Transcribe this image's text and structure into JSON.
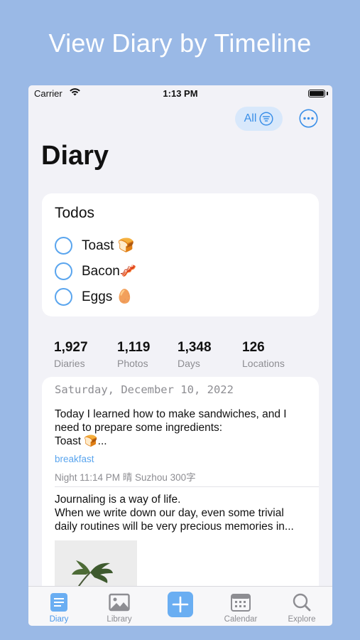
{
  "headline": "View Diary by Timeline",
  "status_bar": {
    "carrier": "Carrier",
    "time": "1:13 PM"
  },
  "toolbar": {
    "filter_label": "All",
    "filter_icon": "filter-icon",
    "more_icon": "ellipsis-circle-icon"
  },
  "page_title": "Diary",
  "todos": {
    "title": "Todos",
    "items": [
      {
        "label": "Toast 🍞",
        "done": false
      },
      {
        "label": "Bacon🥓",
        "done": false
      },
      {
        "label": "Eggs 🥚",
        "done": false
      }
    ]
  },
  "stats": [
    {
      "value": "1,927",
      "label": "Diaries"
    },
    {
      "value": "1,119",
      "label": "Photos"
    },
    {
      "value": "1,348",
      "label": "Days"
    },
    {
      "value": "126",
      "label": "Locations"
    }
  ],
  "entries": [
    {
      "date": "Saturday, December 10, 2022",
      "text_lines": [
        "Today I learned how to make sandwiches, and I",
        "need to prepare some ingredients:",
        "Toast 🍞..."
      ],
      "tag": "breakfast",
      "meta": "Night 11:14 PM  晴  Suzhou  300字"
    },
    {
      "text_lines": [
        "Journaling is a way of life.",
        "When we write down our day, even some trivial",
        "daily routines will be very precious memories in..."
      ]
    }
  ],
  "tabs": [
    {
      "label": "Diary",
      "icon": "diary-icon",
      "active": true
    },
    {
      "label": "Library",
      "icon": "photo-icon",
      "active": false
    },
    {
      "label": "",
      "icon": "plus-icon",
      "active": false
    },
    {
      "label": "Calendar",
      "icon": "calendar-icon",
      "active": false
    },
    {
      "label": "Explore",
      "icon": "search-icon",
      "active": false
    }
  ],
  "colors": {
    "background": "#9ab9e6",
    "accent": "#4a98ea",
    "card": "#ffffff",
    "screen": "#f2f2f7"
  }
}
